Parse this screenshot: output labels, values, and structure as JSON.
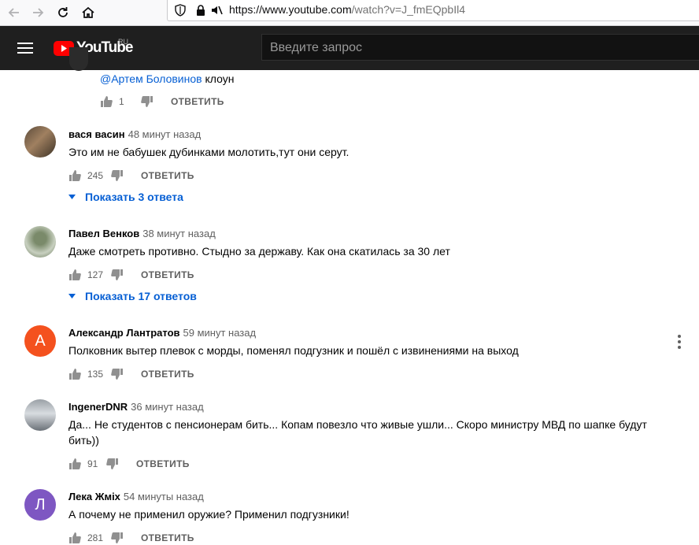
{
  "browser": {
    "url_host": "https://www.youtube.com",
    "url_rest": "/watch?v=J_fmEQpbIl4"
  },
  "header": {
    "logo_text": "YouTube",
    "logo_region": "RU",
    "search_placeholder": "Введите запрос",
    "brand_color": "#ff0000"
  },
  "reply_partial": {
    "mention": "@Артем Боловинов",
    "text": " клоун",
    "likes": "1",
    "reply_label": "ОТВЕТИТЬ"
  },
  "comments": [
    {
      "author": "вася васин",
      "time": "48 минут назад",
      "text": "Это им не бабушек дубинками молотить,тут они серут.",
      "likes": "245",
      "reply_label": "ОТВЕТИТЬ",
      "show_replies": "Показать 3 ответа"
    },
    {
      "author": "Павел Венков",
      "time": "38 минут назад",
      "text": "Даже смотреть противно. Стыдно за державу. Как она скатилась за 30 лет",
      "likes": "127",
      "reply_label": "ОТВЕТИТЬ",
      "show_replies": "Показать 17 ответов"
    },
    {
      "author": "Александр Лантратов",
      "time": "59 минут назад",
      "text": "Полковник вытер плевок с морды, поменял подгузник и пошёл с извинениями на выход",
      "likes": "135",
      "reply_label": "ОТВЕТИТЬ",
      "avatar_letter": "А",
      "avatar_color": "#f4511e"
    },
    {
      "author": "IngenerDNR",
      "time": "36 минут назад",
      "text": "Да... Не студентов с пенсионерам бить... Копам повезло что живые ушли... Скоро министру МВД по шапке будут бить))",
      "likes": "91",
      "reply_label": "ОТВЕТИТЬ"
    },
    {
      "author": "Лека Жміх",
      "time": "54 минуты назад",
      "text": "А почему не применил оружие? Применил подгузники!",
      "likes": "281",
      "reply_label": "ОТВЕТИТЬ",
      "avatar_letter": "Л",
      "avatar_color": "#7e57c2"
    }
  ]
}
